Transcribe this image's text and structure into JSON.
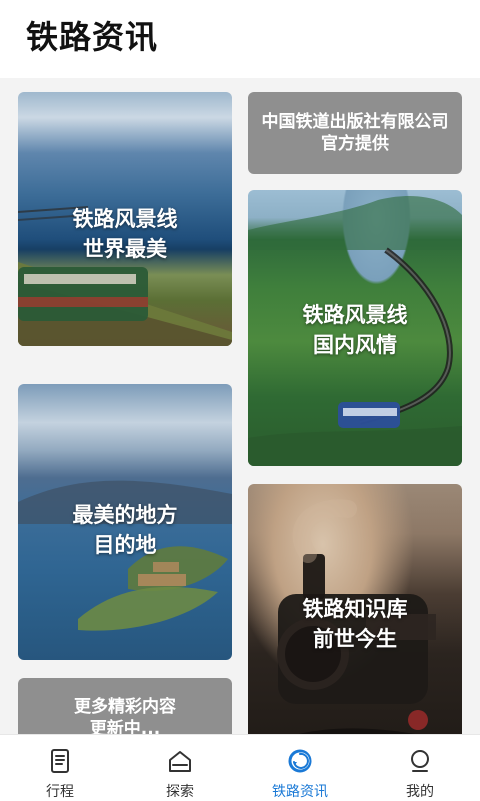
{
  "header": {
    "title": "铁路资讯"
  },
  "cards": {
    "provider": "中国铁道出版社有限公司\n官方提供",
    "world": "铁路风景线\n世界最美",
    "domestic": "铁路风景线\n国内风情",
    "beautiful": "最美的地方\n目的地",
    "knowledge": "铁路知识库\n前世今生",
    "more": "更多精彩内容\n更新中..."
  },
  "tabbar": {
    "items": [
      {
        "label": "行程",
        "icon": "document-icon"
      },
      {
        "label": "探索",
        "icon": "home-icon"
      },
      {
        "label": "铁路资讯",
        "icon": "circular-arrow-icon"
      },
      {
        "label": "我的",
        "icon": "profile-icon"
      }
    ],
    "active_color": "#1a79d6"
  }
}
